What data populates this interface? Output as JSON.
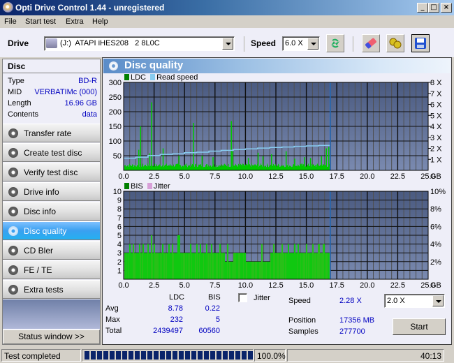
{
  "window": {
    "title": "Opti Drive Control 1.44 - unregistered",
    "controls": [
      "minimize",
      "maximize",
      "close"
    ]
  },
  "menu": [
    "File",
    "Start test",
    "Extra",
    "Help"
  ],
  "toolbar": {
    "drive_label": "Drive",
    "drive_value": "(J:)  ATAPI iHES208   2 8L0C",
    "speed_label": "Speed",
    "speed_value": "6.0 X",
    "buttons": [
      "refresh-icon",
      "erase-icon",
      "copy-icon",
      "save-icon"
    ]
  },
  "disc": {
    "header": "Disc",
    "rows": [
      {
        "key": "Type",
        "value": "BD-R"
      },
      {
        "key": "MID",
        "value": "VERBATIMc (000)"
      },
      {
        "key": "Length",
        "value": "16.96 GB"
      },
      {
        "key": "Contents",
        "value": "data"
      }
    ]
  },
  "nav": {
    "items": [
      {
        "label": "Transfer rate",
        "active": false
      },
      {
        "label": "Create test disc",
        "active": false
      },
      {
        "label": "Verify test disc",
        "active": false
      },
      {
        "label": "Drive info",
        "active": false
      },
      {
        "label": "Disc info",
        "active": false
      },
      {
        "label": "Disc quality",
        "active": true
      },
      {
        "label": "CD Bler",
        "active": false
      },
      {
        "label": "FE / TE",
        "active": false
      },
      {
        "label": "Extra tests",
        "active": false
      }
    ],
    "status_window": "Status window >>"
  },
  "panel": {
    "title": "Disc quality"
  },
  "colors": {
    "ldc": "#00c800",
    "read_speed": "#88ccf0",
    "bis": "#00c800",
    "jitter": "#d8a0d8",
    "position_marker": "#2070d0",
    "active_nav": "#3aa0f0",
    "value_text": "#0000c0"
  },
  "chart_data": [
    {
      "type": "bar",
      "title": "",
      "legend": [
        "LDC",
        "Read speed"
      ],
      "legend_placement": "top-left",
      "xlabel": "GB",
      "x_ticks": [
        "0.0",
        "2.5",
        "5.0",
        "7.5",
        "10.0",
        "12.5",
        "15.0",
        "17.5",
        "20.0",
        "22.5",
        "25.0"
      ],
      "xlim": [
        0,
        25
      ],
      "ylim": [
        0,
        300
      ],
      "y_ticks": [
        "50",
        "100",
        "150",
        "200",
        "250",
        "300"
      ],
      "y2_ticks": [
        "1 X",
        "2 X",
        "3 X",
        "4 X",
        "5 X",
        "6 X",
        "7 X",
        "8 X"
      ],
      "y2lim": [
        0,
        8
      ],
      "grid": true,
      "position_marker_gb": 16.96,
      "series": [
        {
          "name": "LDC",
          "baseline": 22,
          "spikes": [
            [
              1.2,
              70
            ],
            [
              1.35,
              150
            ],
            [
              2.1,
              58
            ],
            [
              2.25,
              232
            ],
            [
              3.2,
              75
            ],
            [
              4.5,
              50
            ],
            [
              5.7,
              162
            ],
            [
              6.4,
              50
            ],
            [
              7.3,
              45
            ],
            [
              8.8,
              168
            ],
            [
              8.9,
              65
            ],
            [
              10.2,
              42
            ],
            [
              11.0,
              60
            ],
            [
              11.4,
              48
            ],
            [
              12.1,
              55
            ],
            [
              13.3,
              65
            ],
            [
              14.0,
              40
            ],
            [
              14.8,
              45
            ],
            [
              15.3,
              42
            ],
            [
              16.2,
              48
            ],
            [
              16.6,
              75
            ],
            [
              16.8,
              80
            ]
          ]
        },
        {
          "name": "Read speed",
          "unit": "X",
          "points": [
            [
              0,
              1.1
            ],
            [
              1.0,
              1.2
            ],
            [
              2.0,
              1.35
            ],
            [
              3.0,
              1.45
            ],
            [
              4.0,
              1.5
            ],
            [
              5.0,
              1.6
            ],
            [
              6.0,
              1.65
            ],
            [
              7.0,
              1.75
            ],
            [
              8.0,
              1.82
            ],
            [
              9.0,
              1.9
            ],
            [
              10.0,
              1.95
            ],
            [
              11.0,
              2.02
            ],
            [
              12.0,
              2.08
            ],
            [
              13.0,
              2.12
            ],
            [
              14.0,
              2.18
            ],
            [
              15.0,
              2.22
            ],
            [
              16.0,
              2.26
            ],
            [
              16.96,
              2.3
            ]
          ]
        }
      ]
    },
    {
      "type": "bar",
      "title": "",
      "legend": [
        "BIS",
        "Jitter"
      ],
      "legend_placement": "top-left",
      "xlabel": "GB",
      "x_ticks": [
        "0.0",
        "2.5",
        "5.0",
        "7.5",
        "10.0",
        "12.5",
        "15.0",
        "17.5",
        "20.0",
        "22.5",
        "25.0"
      ],
      "xlim": [
        0,
        25
      ],
      "ylim": [
        0,
        10
      ],
      "y_ticks": [
        "1",
        "2",
        "3",
        "4",
        "5",
        "6",
        "7",
        "8",
        "9",
        "10"
      ],
      "y2_ticks": [
        "2%",
        "4%",
        "6%",
        "8%",
        "10%"
      ],
      "y2lim": [
        0,
        10
      ],
      "grid": true,
      "position_marker_gb": 16.96,
      "series": [
        {
          "name": "BIS",
          "segments": [
            [
              0,
              3
            ],
            [
              2.0,
              3
            ],
            [
              2.2,
              5
            ],
            [
              2.3,
              3
            ],
            [
              4.4,
              5
            ],
            [
              4.6,
              3
            ],
            [
              8.3,
              2
            ],
            [
              9.0,
              3
            ],
            [
              10.0,
              2
            ],
            [
              11.5,
              2
            ],
            [
              12.0,
              3
            ],
            [
              13.0,
              3
            ],
            [
              16.96,
              3
            ]
          ],
          "peaks_4": [
            0.5,
            0.8,
            1.3,
            1.6,
            2.0,
            2.5,
            3.2,
            3.7,
            4.0,
            5.5,
            6.0,
            6.3,
            6.8,
            7.2,
            7.9,
            8.5,
            11.3,
            12.3,
            13.0,
            13.5,
            14.0,
            14.3,
            15.0,
            15.5,
            16.0,
            16.4
          ],
          "max": 5
        },
        {
          "name": "Jitter",
          "values": []
        }
      ]
    }
  ],
  "stats": {
    "col_headers": [
      "LDC",
      "BIS"
    ],
    "rows": [
      {
        "label": "Avg",
        "ldc": "8.78",
        "bis": "0.22"
      },
      {
        "label": "Max",
        "ldc": "232",
        "bis": "5"
      },
      {
        "label": "Total",
        "ldc": "2439497",
        "bis": "60560"
      }
    ],
    "jitter_label": "Jitter",
    "jitter_checked": false,
    "speed_label": "Speed",
    "speed_value": "2.28 X",
    "speed_select": "2.0 X",
    "position_label": "Position",
    "position_value": "17356 MB",
    "samples_label": "Samples",
    "samples_value": "277700",
    "start_label": "Start"
  },
  "statusbar": {
    "message": "Test completed",
    "progress_percent": 100,
    "progress_text": "100.0%",
    "elapsed": "40:13"
  }
}
